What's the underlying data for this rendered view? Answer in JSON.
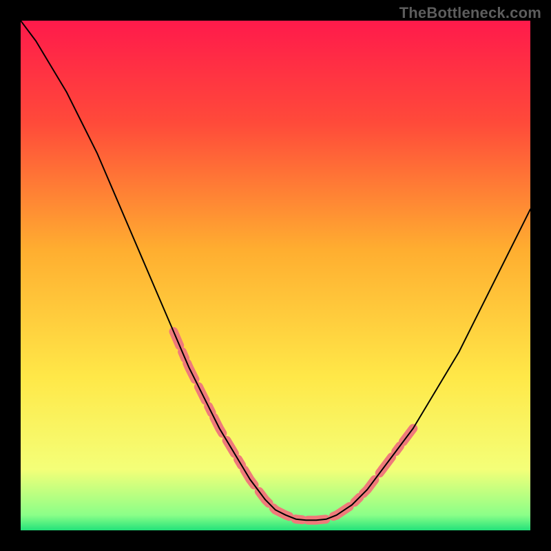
{
  "watermark": "TheBottleneck.com",
  "chart_data": {
    "type": "line",
    "title": "",
    "xlabel": "",
    "ylabel": "",
    "xlim": [
      0,
      100
    ],
    "ylim": [
      0,
      100
    ],
    "grid": false,
    "gradient": {
      "stops": [
        {
          "offset": 0.0,
          "color": "#ff1a4b"
        },
        {
          "offset": 0.2,
          "color": "#ff4a3a"
        },
        {
          "offset": 0.45,
          "color": "#ffae30"
        },
        {
          "offset": 0.7,
          "color": "#ffe848"
        },
        {
          "offset": 0.88,
          "color": "#f4ff78"
        },
        {
          "offset": 0.97,
          "color": "#8bff88"
        },
        {
          "offset": 1.0,
          "color": "#23e27a"
        }
      ]
    },
    "series": [
      {
        "name": "curve",
        "color": "#000000",
        "width": 2.0,
        "x": [
          0,
          3,
          6,
          9,
          12,
          15,
          18,
          21,
          24,
          27,
          30,
          33,
          36,
          39,
          42,
          45,
          48,
          50,
          52,
          54,
          56,
          58,
          60,
          62,
          65,
          68,
          71,
          74,
          77,
          80,
          83,
          86,
          89,
          92,
          95,
          98,
          100
        ],
        "y": [
          100,
          96,
          91,
          86,
          80,
          74,
          67,
          60,
          53,
          46,
          39,
          32,
          26,
          20,
          15,
          10,
          6,
          4,
          3,
          2.2,
          2,
          2,
          2.2,
          3,
          5,
          8,
          12,
          16,
          20,
          25,
          30,
          35,
          41,
          47,
          53,
          59,
          63
        ]
      },
      {
        "name": "band-left",
        "color": "#ef7a7a",
        "width": 13,
        "x": [
          30,
          33,
          36,
          39,
          42,
          45,
          48,
          50
        ],
        "y": [
          39,
          32,
          26,
          20,
          15,
          10,
          6,
          4
        ]
      },
      {
        "name": "band-bottom",
        "color": "#ef7a7a",
        "width": 13,
        "x": [
          50,
          52,
          54,
          56,
          58,
          60,
          62
        ],
        "y": [
          4,
          3,
          2.2,
          2,
          2,
          2.2,
          3
        ]
      },
      {
        "name": "band-right",
        "color": "#ef7a7a",
        "width": 13,
        "x": [
          62,
          65,
          68,
          71
        ],
        "y": [
          3,
          5,
          8,
          12
        ]
      },
      {
        "name": "band-right2",
        "color": "#ef7a7a",
        "width": 13,
        "x": [
          71,
          74,
          77
        ],
        "y": [
          12,
          16,
          20
        ]
      }
    ]
  }
}
